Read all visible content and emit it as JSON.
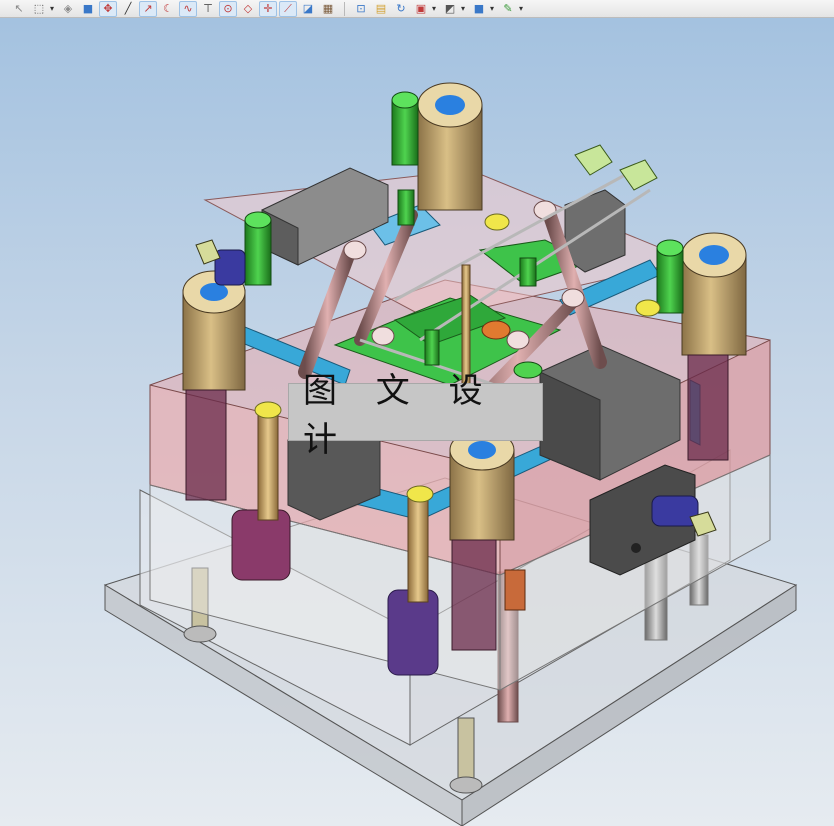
{
  "toolbar": {
    "items": [
      {
        "name": "select-filter-icon",
        "glyph": "↖",
        "dropdown": false,
        "active": false,
        "color": "#888888"
      },
      {
        "name": "box-select-icon",
        "glyph": "⬚",
        "dropdown": true,
        "active": false,
        "color": "#555555"
      },
      {
        "name": "eraser-icon",
        "glyph": "◈",
        "dropdown": false,
        "active": false,
        "color": "#8a8a8a"
      },
      {
        "name": "solid-cube-icon",
        "glyph": "■",
        "dropdown": false,
        "active": false,
        "color": "#3a78c8"
      },
      {
        "name": "snap-all-icon",
        "glyph": "✥",
        "dropdown": false,
        "active": true,
        "color": "#c03a3a"
      },
      {
        "name": "line-snap-icon",
        "glyph": "╱",
        "dropdown": false,
        "active": false,
        "color": "#333333"
      },
      {
        "name": "endpoint-snap-icon",
        "glyph": "↗",
        "dropdown": false,
        "active": true,
        "color": "#c03a3a"
      },
      {
        "name": "arc-snap-icon",
        "glyph": "☾",
        "dropdown": false,
        "active": false,
        "color": "#c03a3a"
      },
      {
        "name": "curve-snap-icon",
        "glyph": "∿",
        "dropdown": false,
        "active": true,
        "color": "#c03a3a"
      },
      {
        "name": "tangent-snap-icon",
        "glyph": "⊤",
        "dropdown": false,
        "active": false,
        "color": "#333333"
      },
      {
        "name": "center-snap-icon",
        "glyph": "⊙",
        "dropdown": false,
        "active": true,
        "color": "#c03a3a"
      },
      {
        "name": "quadrant-snap-icon",
        "glyph": "◇",
        "dropdown": false,
        "active": false,
        "color": "#c03a3a"
      },
      {
        "name": "intersection-snap-icon",
        "glyph": "✛",
        "dropdown": false,
        "active": true,
        "color": "#c03a3a"
      },
      {
        "name": "perpendicular-snap-icon",
        "glyph": "⟋",
        "dropdown": false,
        "active": true,
        "color": "#c03a3a"
      },
      {
        "name": "point-on-face-icon",
        "glyph": "◪",
        "dropdown": false,
        "active": false,
        "color": "#3a78c8"
      },
      {
        "name": "grid-icon",
        "glyph": "▦",
        "dropdown": false,
        "active": false,
        "color": "#7a5a3a"
      },
      {
        "name": "separator",
        "glyph": "",
        "dropdown": false,
        "active": false,
        "color": ""
      },
      {
        "name": "fit-view-icon",
        "glyph": "⊡",
        "dropdown": false,
        "active": false,
        "color": "#3a78c8"
      },
      {
        "name": "zoom-region-icon",
        "glyph": "▤",
        "dropdown": false,
        "active": false,
        "color": "#d2a030"
      },
      {
        "name": "rotate-view-icon",
        "glyph": "↻",
        "dropdown": false,
        "active": false,
        "color": "#3a78c8"
      },
      {
        "name": "orient-view-icon",
        "glyph": "▣",
        "dropdown": true,
        "active": false,
        "color": "#c03a3a"
      },
      {
        "name": "render-style-icon",
        "glyph": "◩",
        "dropdown": true,
        "active": false,
        "color": "#555555"
      },
      {
        "name": "shaded-cube-icon",
        "glyph": "■",
        "dropdown": true,
        "active": false,
        "color": "#3a78c8"
      },
      {
        "name": "edit-section-icon",
        "glyph": "✎",
        "dropdown": true,
        "active": false,
        "color": "#3a9a3a"
      }
    ]
  },
  "viewport": {
    "background_top": "#a4c2e0",
    "background_bottom": "#e6ebf0"
  },
  "watermark": {
    "text": "图 文 设 计"
  }
}
